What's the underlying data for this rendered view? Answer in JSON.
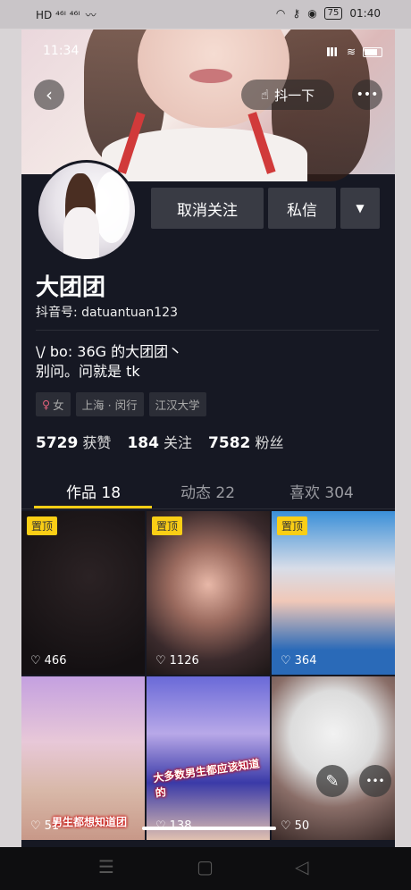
{
  "system_status": {
    "left_icons": "HD ⁴⁶ᴵ ⁴⁶ᴵ",
    "time": "01:40",
    "battery": "75"
  },
  "inner_status": {
    "time": "11:34"
  },
  "header": {
    "back_icon": "back-arrow-icon",
    "shake_label": "抖一下",
    "more_icon": "more-dots-icon"
  },
  "profile": {
    "unfollow_label": "取消关注",
    "message_label": "私信",
    "dropdown_icon": "caret-down-icon",
    "name": "大团团",
    "id_label": "抖音号: datuantuan123",
    "bio_line1": "\\/ bo: 36G 的大团团丶",
    "bio_line2": "别问。问就是 tk",
    "tags": [
      "女",
      "上海 · 闵行",
      "江汉大学"
    ],
    "stats": [
      {
        "value": "5729",
        "label": "获赞"
      },
      {
        "value": "184",
        "label": "关注"
      },
      {
        "value": "7582",
        "label": "粉丝"
      }
    ]
  },
  "tabs": [
    {
      "label": "作品 18"
    },
    {
      "label": "动态 22"
    },
    {
      "label": "喜欢 304"
    }
  ],
  "pinned_label": "置顶",
  "videos": [
    {
      "likes": "466",
      "pinned": true
    },
    {
      "likes": "1126",
      "pinned": true
    },
    {
      "likes": "364",
      "pinned": true
    },
    {
      "likes": "51",
      "pinned": false,
      "caption": "男生都想知道团"
    },
    {
      "likes": "138",
      "pinned": false,
      "caption": "大多数男生都应该知道的"
    },
    {
      "likes": "50",
      "pinned": false
    }
  ],
  "colors": {
    "accent": "#face15",
    "background": "#161823"
  }
}
